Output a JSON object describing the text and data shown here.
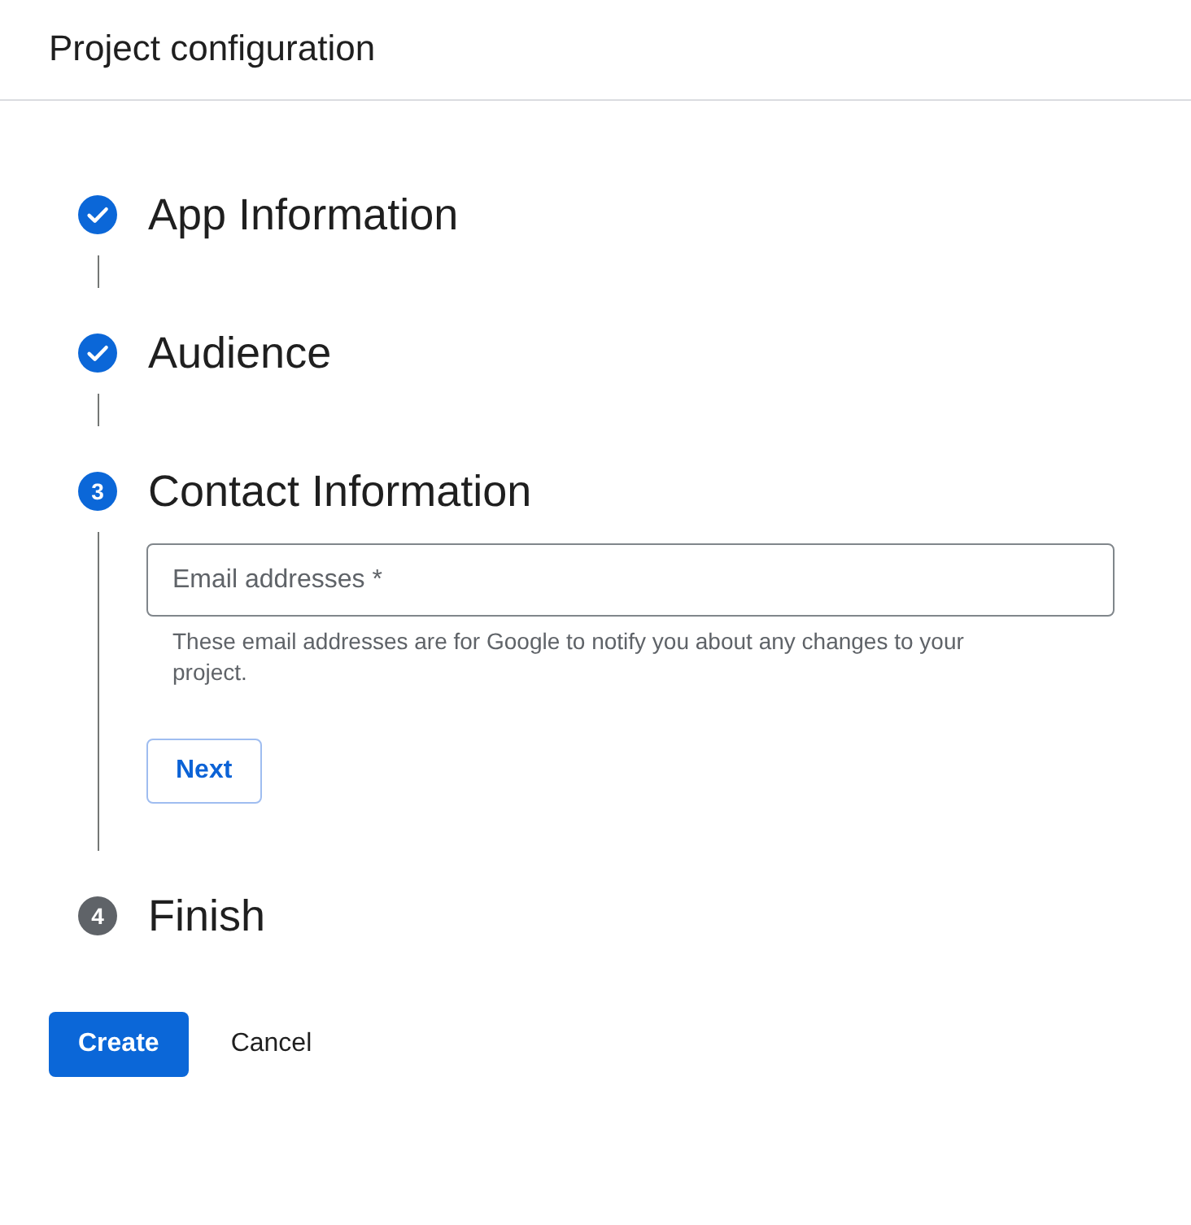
{
  "header": {
    "title": "Project configuration"
  },
  "steps": [
    {
      "kind": "completed",
      "title": "App Information"
    },
    {
      "kind": "completed",
      "title": "Audience"
    },
    {
      "kind": "active",
      "number": "3",
      "title": "Contact Information",
      "field": {
        "placeholder": "Email addresses *"
      },
      "hint": "These email addresses are for Google to notify you about any changes to your project.",
      "button": "Next"
    },
    {
      "kind": "pending",
      "number": "4",
      "title": "Finish"
    }
  ],
  "actions": [
    {
      "kind": "primary",
      "label": "Create"
    },
    {
      "kind": "text",
      "label": "Cancel"
    }
  ]
}
